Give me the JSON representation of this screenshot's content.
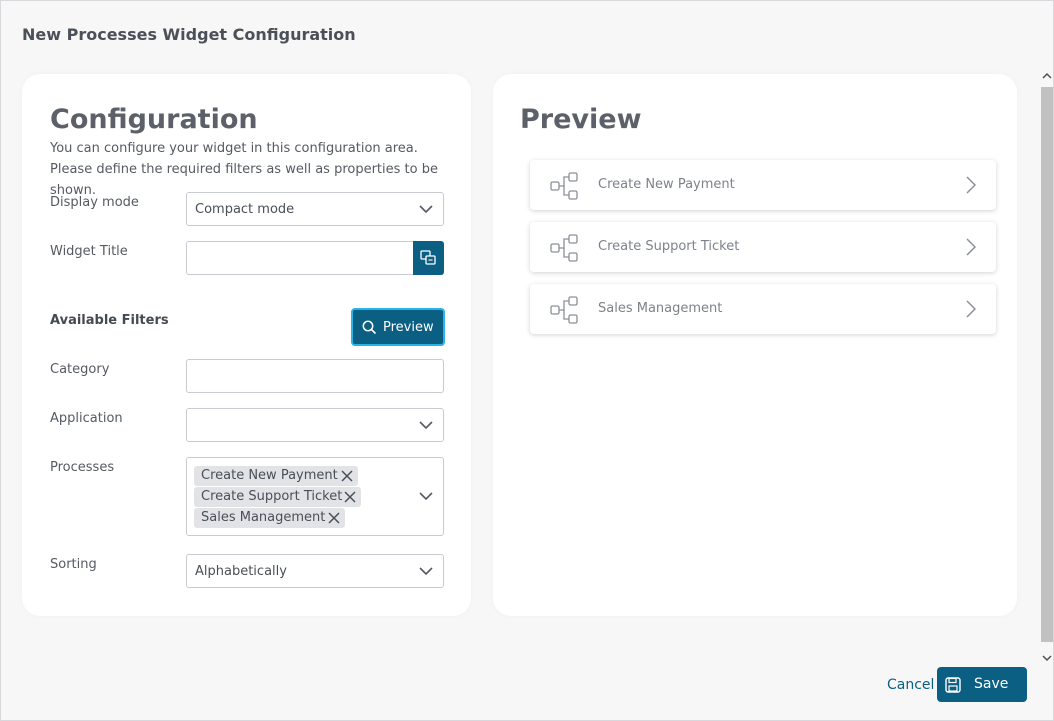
{
  "dialog": {
    "title": "New Processes Widget Configuration"
  },
  "config": {
    "heading": "Configuration",
    "description": "You can configure your widget in this configuration area. Please define the required filters as well as properties to be shown.",
    "display_mode": {
      "label": "Display mode",
      "value": "Compact mode"
    },
    "widget_title": {
      "label": "Widget Title",
      "value": ""
    },
    "available_filters": {
      "label": "Available Filters",
      "preview_button": "Preview"
    },
    "category": {
      "label": "Category",
      "value": ""
    },
    "application": {
      "label": "Application",
      "value": ""
    },
    "processes": {
      "label": "Processes",
      "tags": [
        "Create New Payment",
        "Create Support Ticket",
        "Sales Management"
      ]
    },
    "sorting": {
      "label": "Sorting",
      "value": "Alphabetically"
    }
  },
  "preview": {
    "heading": "Preview",
    "items": [
      {
        "name": "Create New Payment",
        "icon": "process-flow-icon"
      },
      {
        "name": "Create Support Ticket",
        "icon": "process-flow-icon"
      },
      {
        "name": "Sales Management",
        "icon": "process-flow-icon"
      }
    ]
  },
  "footer": {
    "cancel": "Cancel",
    "save": "Save"
  },
  "colors": {
    "primary": "#0b5f83",
    "focus": "#29b3e8",
    "tag_bg": "#e1e3e7"
  }
}
